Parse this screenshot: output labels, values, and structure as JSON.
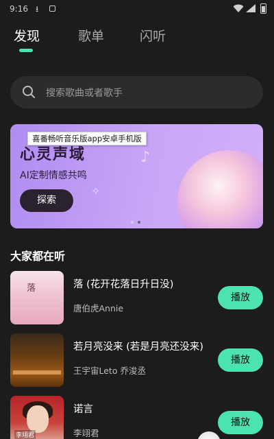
{
  "status_bar": {
    "time": "9:16",
    "download_glyph": "⭳",
    "wifi_icon": "wifi-icon",
    "cell_icon": "cell-signal-icon",
    "battery_icon": "battery-icon"
  },
  "tabs": [
    {
      "label": "发现",
      "active": true
    },
    {
      "label": "歌单",
      "active": false
    },
    {
      "label": "闪听",
      "active": false
    }
  ],
  "search": {
    "placeholder": "搜索歌曲或者歌手",
    "icon": "search-icon"
  },
  "banner": {
    "tooltip": "喜番畅听音乐版app安卓手机版",
    "title": "心灵声域",
    "subtitle": "AI定制情感共鸣",
    "button_label": "探索",
    "page_count": 2,
    "active_page": 2
  },
  "section": {
    "title": "大家都在听"
  },
  "songs": [
    {
      "title": "落 (花开花落日升日没)",
      "artist": "唐伯虎Annie",
      "play_label": "播放",
      "cover_text": "落"
    },
    {
      "title": "若月亮没来 (若是月亮还没来)",
      "artist": "王宇宙Leto 乔浚丞",
      "play_label": "播放"
    },
    {
      "title": "诺言",
      "artist": "李翊君",
      "play_label": "播放",
      "cover_text": "李翊君"
    }
  ],
  "colors": {
    "accent": "#4de3b0",
    "background": "#1c1c1c",
    "search_bg": "#2c2c2c"
  }
}
